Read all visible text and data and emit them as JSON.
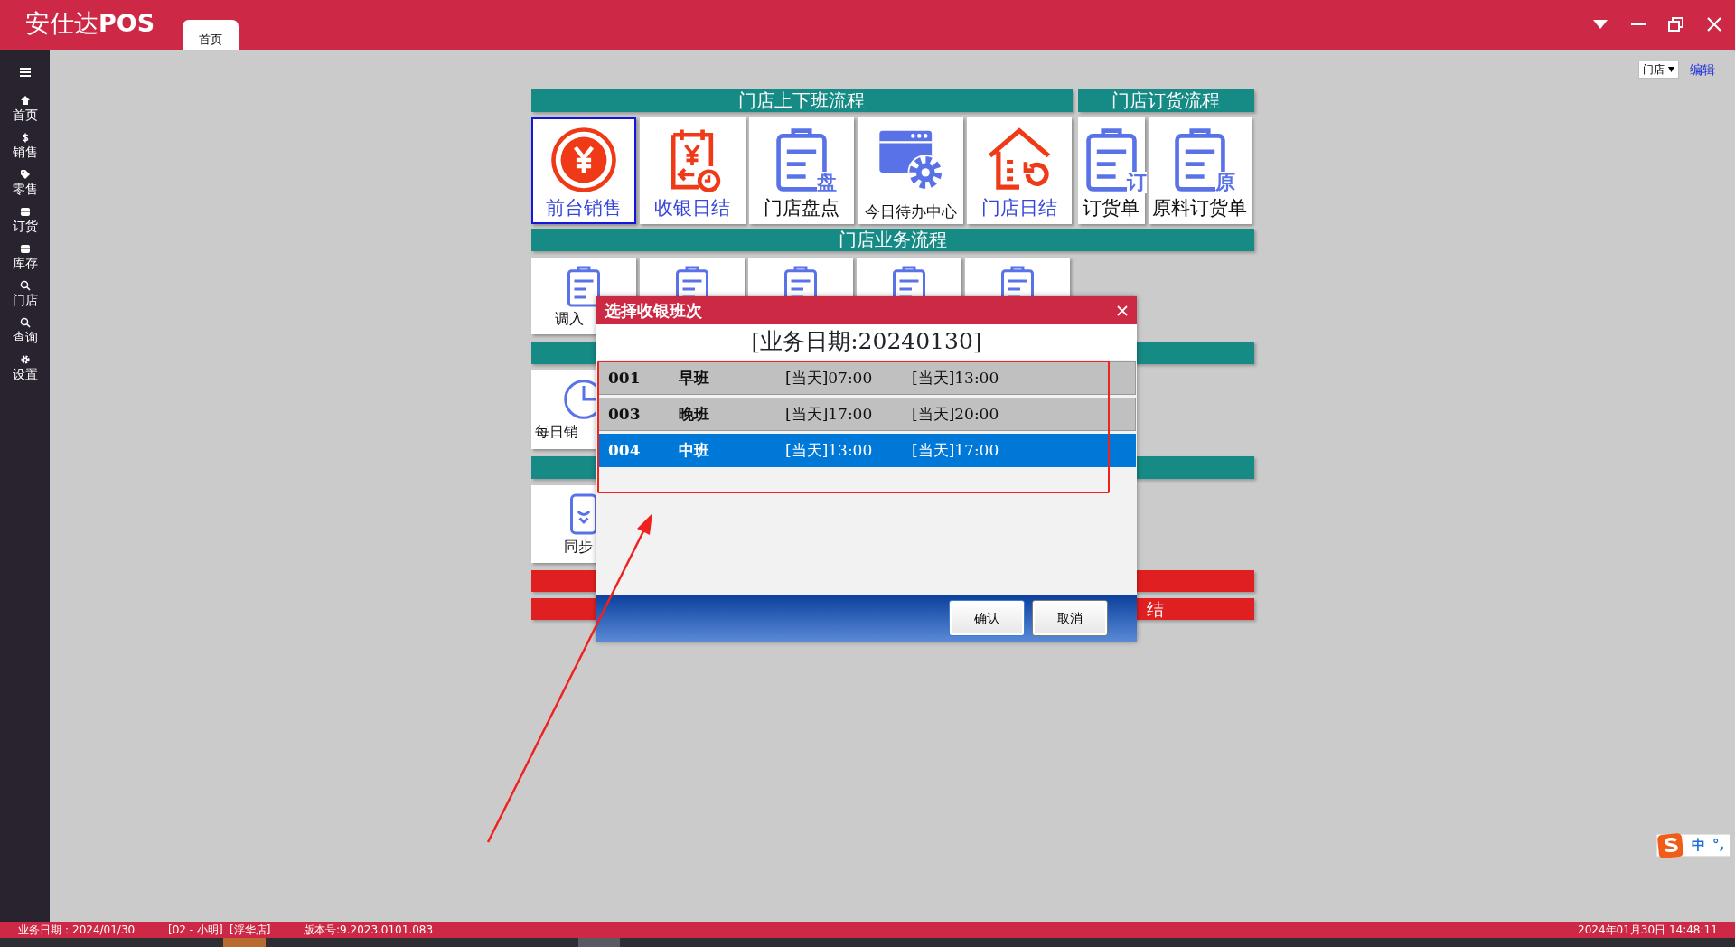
{
  "app": {
    "logo": "安仕达**POS**"
  },
  "tabs": [
    {
      "label": "首页",
      "selected": true
    }
  ],
  "sidebar": {
    "items": [
      {
        "label": "首页"
      },
      {
        "label": "销售"
      },
      {
        "label": "零售"
      },
      {
        "label": "订货"
      },
      {
        "label": "库存"
      },
      {
        "label": "门店"
      },
      {
        "label": "查询"
      },
      {
        "label": "设置"
      }
    ]
  },
  "toolbar": {
    "store_select": "门店",
    "edit_link": "编辑"
  },
  "flow_rows": [
    {
      "groups": [
        {
          "title": "门店上下班流程",
          "tiles": [
            {
              "label": "前台销售",
              "selected": true,
              "highlight": true,
              "kind": "coin"
            },
            {
              "label": "收银日结",
              "selected": false,
              "highlight": true,
              "kind": "receipt"
            },
            {
              "label": "门店盘点",
              "selected": false,
              "highlight": false,
              "kind": "clipboard",
              "icon_text": "盘"
            },
            {
              "label": "今日待办中心",
              "selected": false,
              "highlight": false,
              "kind": "window-gear"
            },
            {
              "label": "门店日结",
              "selected": false,
              "highlight": true,
              "kind": "house"
            }
          ]
        },
        {
          "title": "门店订货流程",
          "tiles": [
            {
              "label": "订货单",
              "selected": false,
              "highlight": false,
              "kind": "clipboard",
              "icon_text": "订"
            },
            {
              "label": "原料订货单",
              "selected": false,
              "highlight": false,
              "kind": "clipboard",
              "icon_text": "原"
            }
          ]
        }
      ]
    },
    {
      "groups": [
        {
          "title": "门店业务流程",
          "tiles": [
            {
              "label": "调入",
              "selected": false,
              "highlight": false,
              "kind": "clipboard"
            },
            {
              "selected": false,
              "kind": "clipboard"
            },
            {
              "selected": false,
              "kind": "clipboard"
            },
            {
              "selected": false,
              "kind": "clipboard"
            },
            {
              "selected": false,
              "kind": "clipboard"
            }
          ]
        }
      ]
    },
    {
      "groups": [
        {
          "tiles": [
            {
              "label": "每日销",
              "selected": false,
              "highlight": false,
              "kind": "clock"
            }
          ]
        }
      ]
    },
    {
      "groups": [
        {
          "tiles": [
            {
              "label": "同步",
              "selected": false,
              "highlight": false,
              "kind": "sync"
            }
          ]
        }
      ]
    }
  ],
  "action_bars": [
    {
      "kind": "blank"
    },
    {
      "kind": "text",
      "label": "结"
    }
  ],
  "dialog": {
    "title": "选择收银班次",
    "date_heading": "[业务日期:20240130]",
    "shifts": [
      {
        "code": "001",
        "name": "早班",
        "start": "[当天]07:00",
        "end": "[当天]13:00",
        "selected": false
      },
      {
        "code": "003",
        "name": "晚班",
        "start": "[当天]17:00",
        "end": "[当天]20:00",
        "selected": false
      },
      {
        "code": "004",
        "name": "中班",
        "start": "[当天]13:00",
        "end": "[当天]17:00",
        "selected": true
      }
    ],
    "buttons": [
      "确认",
      "取消"
    ]
  },
  "ime": {
    "mode": "中",
    "punctuation": "°,"
  },
  "status_bar": {
    "business_date": "业务日期：2024/01/30",
    "operator": "[02 - 小明]",
    "store": "[浮华店]",
    "version": "版本号:9.2023.0101.083",
    "datetime": "2024年01月30日 14:48:11"
  }
}
